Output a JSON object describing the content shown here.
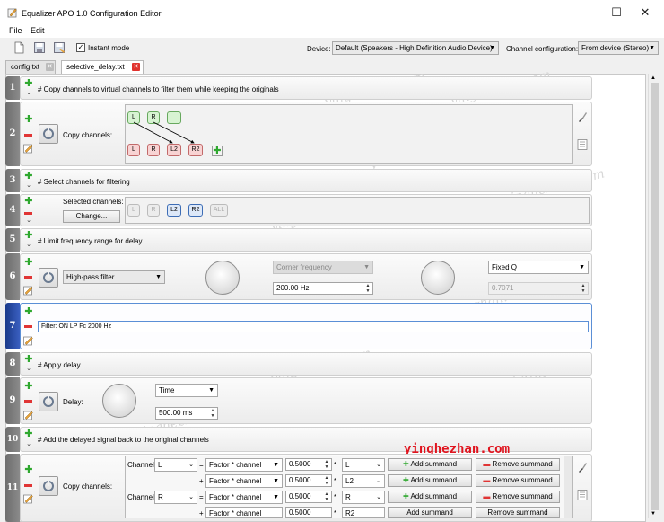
{
  "window": {
    "title": "Equalizer APO 1.0 Configuration Editor",
    "minimize": "—",
    "maximize": "☐",
    "close": "✕"
  },
  "menu": [
    "File",
    "Edit"
  ],
  "toolbar": {
    "instant_mode_label": "Instant mode",
    "instant_mode_checked": "✓",
    "device_label": "Device:",
    "device_value": "Default (Speakers - High Definition Audio Device)",
    "channel_config_label": "Channel configuration:",
    "channel_config_value": "From device (Stereo)"
  },
  "tabs": [
    {
      "label": "config.txt",
      "active": false
    },
    {
      "label": "selective_delay.txt",
      "active": true
    }
  ],
  "rows": [
    {
      "num": "1",
      "comment": "# Copy channels to virtual channels to filter them while keeping the originals"
    },
    {
      "num": "2",
      "label": "Copy channels:",
      "sources": [
        "L",
        "R",
        ""
      ],
      "targets": [
        "L",
        "R",
        "L2",
        "R2"
      ]
    },
    {
      "num": "3",
      "comment": "# Select channels for filtering"
    },
    {
      "num": "4",
      "label": "Selected channels:",
      "change_button": "Change...",
      "channels": [
        "L",
        "R",
        "L2",
        "R2",
        "ALL"
      ]
    },
    {
      "num": "5",
      "comment": "# Limit frequency range for delay"
    },
    {
      "num": "6",
      "filter_type": "High-pass filter",
      "corner_label": "Corner frequency",
      "corner_value": "200.00 Hz",
      "q_type": "Fixed Q",
      "q_value": "0.7071"
    },
    {
      "num": "7",
      "text": "Filter: ON LP Fc 2000 Hz"
    },
    {
      "num": "8",
      "comment": "# Apply delay"
    },
    {
      "num": "9",
      "label": "Delay:",
      "unit": "Time",
      "value": "500.00 ms"
    },
    {
      "num": "10",
      "comment": "# Add the delayed signal back to the original channels"
    },
    {
      "num": "11",
      "label": "Copy channels:",
      "lines": [
        {
          "channel_label": "Channel",
          "channel": "L",
          "op": "=",
          "factor": "Factor * channel",
          "value": "0.5000",
          "mult": "*",
          "target": "L",
          "add": "Add summand",
          "remove": "Remove summand"
        },
        {
          "channel_label": "",
          "channel": "",
          "op": "+",
          "factor": "Factor * channel",
          "value": "0.5000",
          "mult": "*",
          "target": "L2",
          "add": "Add summand",
          "remove": "Remove summand"
        },
        {
          "channel_label": "Channel",
          "channel": "R",
          "op": "=",
          "factor": "Factor * channel",
          "value": "0.5000",
          "mult": "*",
          "target": "R",
          "add": "Add summand",
          "remove": "Remove summand"
        },
        {
          "channel_label": "",
          "channel": "",
          "op": "+",
          "factor": "Factor * channel",
          "value": "0.5000",
          "mult": "*",
          "target": "R2",
          "add": "Add summand",
          "remove": "Remove summand"
        }
      ]
    }
  ],
  "watermark": "yinghezhan.com",
  "brand": "yinghezhan.com",
  "colors": {
    "accent": "#5b8fd6",
    "add_green": "#2fa82f",
    "remove_red": "#e03535",
    "brand_red": "#e0141e"
  }
}
